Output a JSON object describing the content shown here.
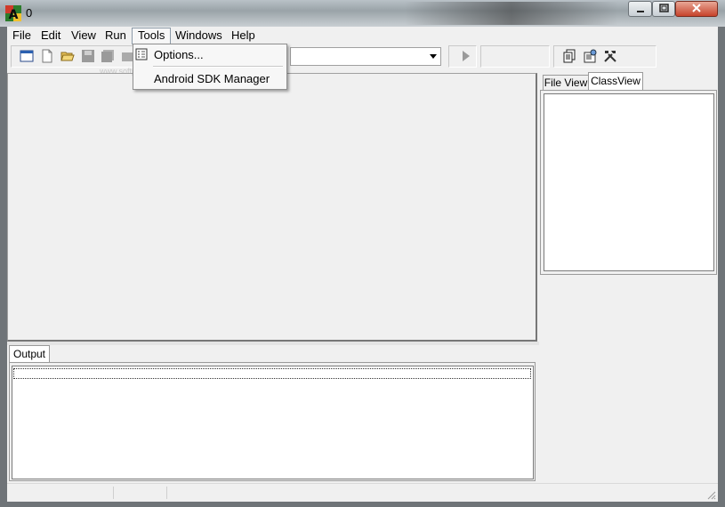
{
  "window": {
    "title": "0",
    "minimize_icon": "minimize-icon",
    "maximize_icon": "maximize-icon",
    "close_icon": "close-icon"
  },
  "menubar": {
    "items": [
      "File",
      "Edit",
      "View",
      "Run",
      "Tools",
      "Windows",
      "Help"
    ]
  },
  "tools_menu": {
    "options_label": "Options...",
    "sdk_label": "Android SDK Manager"
  },
  "toolbar": {
    "icons": [
      "window-icon",
      "new-file-icon",
      "open-folder-icon",
      "save-icon",
      "save-all-icon",
      "close-file-icon",
      "run-icon",
      "copy-icon",
      "properties-icon",
      "tools-icon"
    ],
    "combo_value": ""
  },
  "right_panel": {
    "tabs": [
      "File View",
      "ClassView"
    ],
    "active_tab": "ClassView"
  },
  "output": {
    "tab_label": "Output"
  },
  "watermark": {
    "text": "www.softpedia.com"
  },
  "colors": {
    "accent": "#8c9aa8",
    "background": "#f0f0f0"
  }
}
